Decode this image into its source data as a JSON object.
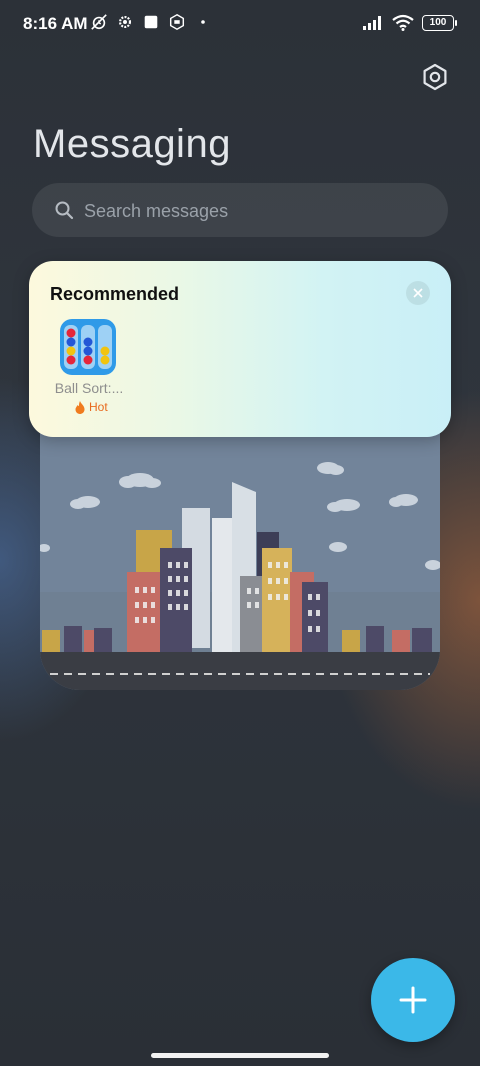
{
  "status_bar": {
    "time": "8:16 AM",
    "battery": "100",
    "icons": [
      "mute-alarm-icon",
      "settings-gear-icon",
      "square-notification-icon",
      "hexagon-app-icon",
      "dot-icon",
      "signal-icon",
      "wifi-icon",
      "battery-icon"
    ]
  },
  "header": {
    "title": "Messaging",
    "settings_icon": "settings-hexagon-icon"
  },
  "search": {
    "placeholder": "Search messages",
    "value": ""
  },
  "recommended": {
    "title": "Recommended",
    "close_icon": "close-icon",
    "apps": [
      {
        "name": "Ball Sort:...",
        "badge": "Hot",
        "badge_icon": "fire-icon"
      }
    ]
  },
  "fab": {
    "icon": "plus-icon"
  },
  "colors": {
    "accent": "#3bb8e8",
    "background": "#2b3038",
    "hot": "#e86a1e"
  }
}
